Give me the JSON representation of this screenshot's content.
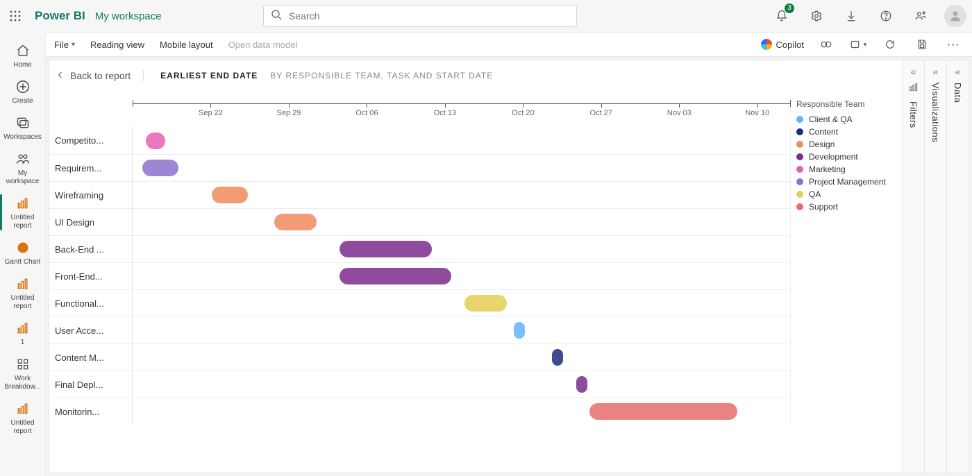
{
  "header": {
    "brand": "Power BI",
    "workspace": "My workspace",
    "search_placeholder": "Search",
    "notification_count": "3"
  },
  "left_rail": [
    {
      "key": "home",
      "label": "Home"
    },
    {
      "key": "create",
      "label": "Create"
    },
    {
      "key": "workspaces",
      "label": "Workspaces"
    },
    {
      "key": "my-workspace",
      "label": "My workspace"
    },
    {
      "key": "untitled-report-1",
      "label": "Untitled report",
      "selected": true
    },
    {
      "key": "gantt-chart",
      "label": "Gantt Chart"
    },
    {
      "key": "untitled-report-2",
      "label": "Untitled report"
    },
    {
      "key": "one",
      "label": "1"
    },
    {
      "key": "work-breakdown",
      "label": "Work Breakdow..."
    },
    {
      "key": "untitled-report-3",
      "label": "Untitled report"
    }
  ],
  "toolbar": {
    "file": "File",
    "reading_view": "Reading view",
    "mobile_layout": "Mobile layout",
    "open_data_model": "Open data model",
    "copilot": "Copilot"
  },
  "panes": {
    "filters": "Filters",
    "visualizations": "Visualizations",
    "data": "Data"
  },
  "chart_header": {
    "back": "Back to report",
    "title": "EARLIEST END DATE",
    "subtitle": "BY RESPONSIBLE TEAM, TASK AND START DATE"
  },
  "legend_title": "Responsible Team",
  "legend": [
    {
      "name": "Client & QA",
      "color": "#62b4ff"
    },
    {
      "name": "Content",
      "color": "#1e2a78"
    },
    {
      "name": "Design",
      "color": "#f08b5e"
    },
    {
      "name": "Development",
      "color": "#7b2d8e"
    },
    {
      "name": "Marketing",
      "color": "#e75fb1"
    },
    {
      "name": "Project Management",
      "color": "#8d71d0"
    },
    {
      "name": "QA",
      "color": "#e5cd55"
    },
    {
      "name": "Support",
      "color": "#e86c6c"
    }
  ],
  "chart_data": {
    "type": "gantt",
    "x_axis_ticks": [
      "Sep 22",
      "Sep 29",
      "Oct 06",
      "Oct 13",
      "Oct 20",
      "Oct 27",
      "Nov 03",
      "Nov 10"
    ],
    "x_start": "Sep 15",
    "x_end": "Nov 13",
    "tasks": [
      {
        "label": "Competito...",
        "team": "Marketing",
        "start_pct": 2.0,
        "width_pct": 3.0
      },
      {
        "label": "Requirem...",
        "team": "Project Management",
        "start_pct": 1.5,
        "width_pct": 5.5
      },
      {
        "label": "Wireframing",
        "team": "Design",
        "start_pct": 12.0,
        "width_pct": 5.5
      },
      {
        "label": "UI Design",
        "team": "Design",
        "start_pct": 21.5,
        "width_pct": 6.5
      },
      {
        "label": "Back-End ...",
        "team": "Development",
        "start_pct": 31.5,
        "width_pct": 14.0
      },
      {
        "label": "Front-End...",
        "team": "Development",
        "start_pct": 31.5,
        "width_pct": 17.0
      },
      {
        "label": "Functional...",
        "team": "QA",
        "start_pct": 50.5,
        "width_pct": 6.4
      },
      {
        "label": "User Acce...",
        "team": "Client & QA",
        "start_pct": 58.0,
        "width_pct": 1.7
      },
      {
        "label": "Content M...",
        "team": "Content",
        "start_pct": 63.8,
        "width_pct": 1.7
      },
      {
        "label": "Final Depl...",
        "team": "Development",
        "start_pct": 67.5,
        "width_pct": 1.7
      },
      {
        "label": "Monitorin...",
        "team": "Support",
        "start_pct": 69.5,
        "width_pct": 22.5
      }
    ]
  }
}
